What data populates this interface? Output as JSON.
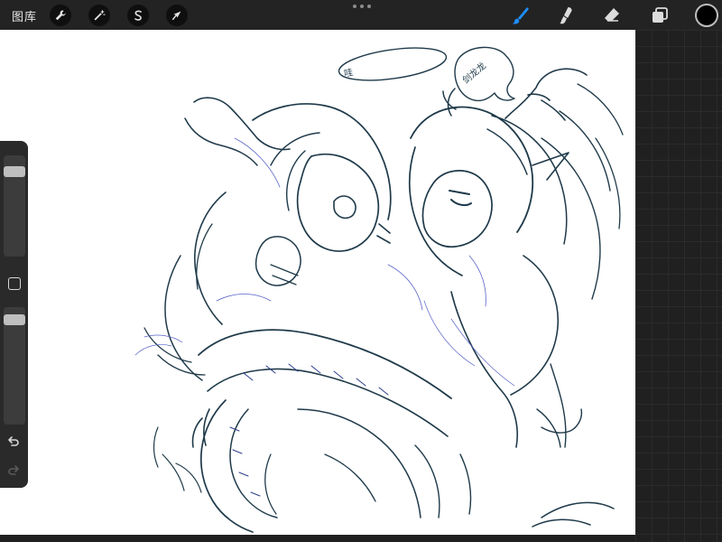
{
  "toolbar": {
    "gallery_label": "图库",
    "left_tools": [
      {
        "name": "actions",
        "icon": "wrench-icon"
      },
      {
        "name": "adjustments",
        "icon": "magic-wand-icon"
      },
      {
        "name": "selection",
        "icon": "selection-s-icon"
      },
      {
        "name": "transform",
        "icon": "arrow-cursor-icon"
      }
    ],
    "right_tools": [
      {
        "name": "brush",
        "icon": "brush-icon",
        "active": true
      },
      {
        "name": "smudge",
        "icon": "smudge-icon"
      },
      {
        "name": "eraser",
        "icon": "eraser-icon"
      },
      {
        "name": "layers",
        "icon": "layers-icon"
      }
    ],
    "current_color": "#000000",
    "active_tool_color": "#1e8fff"
  },
  "sidebar": {
    "brush_size_level": 0.1,
    "opacity_level": 0.05,
    "undo_icon": "undo-icon",
    "redo_icon": "redo-icon"
  },
  "canvas": {
    "annotations": [
      "哇",
      "剑龙龙"
    ]
  }
}
